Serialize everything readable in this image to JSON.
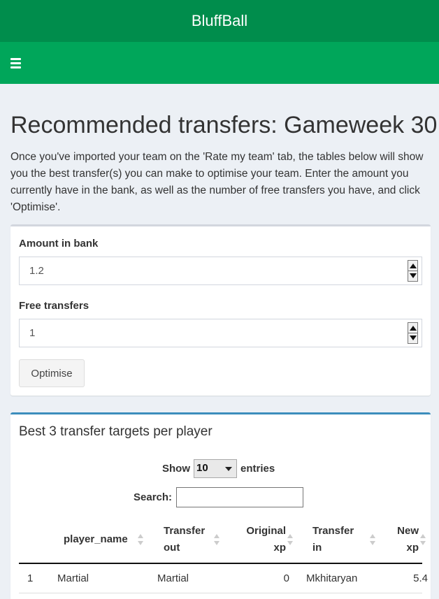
{
  "header": {
    "brand": "BluffBall"
  },
  "navbar": {
    "menu_icon": "hamburger-menu-icon"
  },
  "page": {
    "title": "Recommended transfers: Gameweek 30",
    "intro": "Once you've imported your team on the 'Rate my team' tab, the tables below will show you the best transfer(s) you can make to optimise your team. Enter the amount you currently have in the bank, as well as the number of free transfers you have, and click 'Optimise'."
  },
  "form": {
    "bank_label": "Amount in bank",
    "bank_value": "1.2",
    "free_label": "Free transfers",
    "free_value": "1",
    "optimise_label": "Optimise"
  },
  "table_box": {
    "title": "Best 3 transfer targets per player",
    "show_label": "Show",
    "entries_value": "10",
    "entries_label": "entries",
    "search_label": "Search:",
    "columns": {
      "player_name": "player_name",
      "transfer_out": "Transfer out",
      "original_xp": "Original xp",
      "transfer_in": "Transfer in",
      "new_xp": "New xp"
    },
    "rows": [
      {
        "index": "1",
        "player_name": "Martial",
        "transfer_out": "Martial",
        "original_xp": "0",
        "transfer_in": "Mkhitaryan",
        "new_xp": "5.4"
      }
    ]
  }
}
